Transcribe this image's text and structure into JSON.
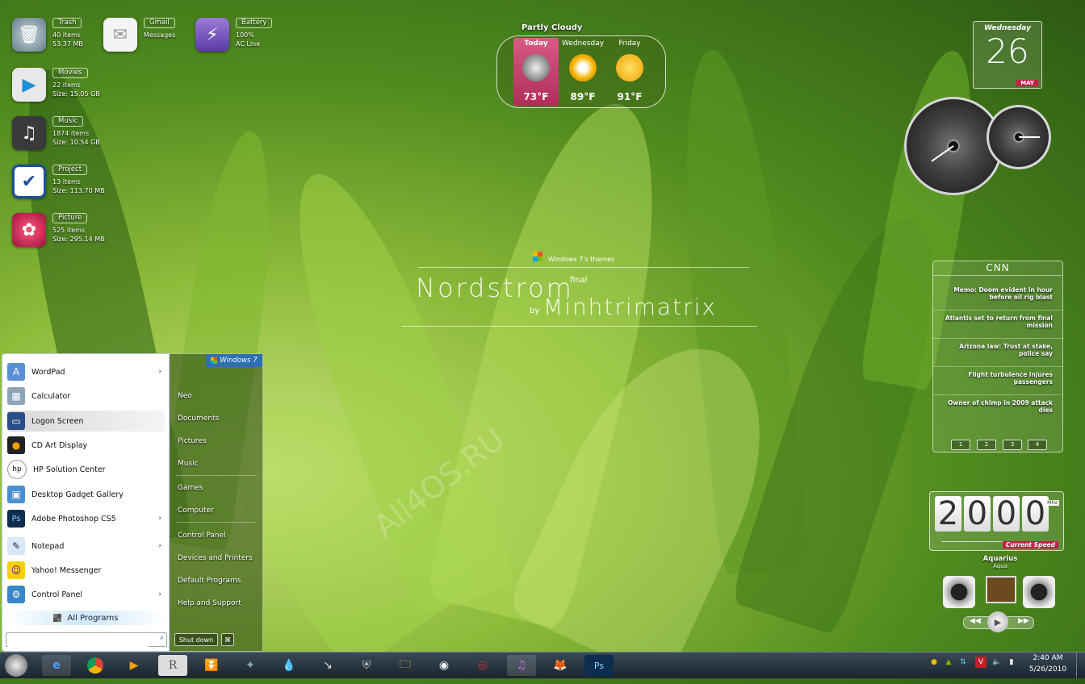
{
  "desktop": {
    "icons": [
      {
        "name": "Trash",
        "line1": "40 items",
        "line2": "53.37 MB"
      },
      {
        "name": "Gmail",
        "line1": "Messages",
        "line2": ""
      },
      {
        "name": "Battery",
        "line1": "100%",
        "line2": "AC Line"
      },
      {
        "name": "Movies",
        "line1": "22 items",
        "line2": "Size: 15.05 GB"
      },
      {
        "name": "Music",
        "line1": "1874 items",
        "line2": "Size: 10.54 GB"
      },
      {
        "name": "Project",
        "line1": "13 items",
        "line2": "Size: 113.70 MB"
      },
      {
        "name": "Picture",
        "line1": "525 items",
        "line2": "Size: 295.14 MB"
      }
    ],
    "banner": {
      "subtitle": "Windows 7's themes",
      "title": "Nordstrom",
      "final": "final",
      "by": "by",
      "author": "Minhtrimatrix"
    },
    "watermark": "All4OS.RU"
  },
  "weather": {
    "condition": "Partly Cloudy",
    "days": [
      {
        "label": "Today",
        "temp": "73°F"
      },
      {
        "label": "Wednesday",
        "temp": "89°F"
      },
      {
        "label": "Friday",
        "temp": "91°F"
      }
    ]
  },
  "calendar": {
    "weekday": "Wednesday",
    "day": "26",
    "month": "MAY"
  },
  "cnn": {
    "title": "CNN",
    "items": [
      "Memo: Doom evident in hour before oil rig blast",
      "Atlantis set to return from final mission",
      "Arizona law: Trust at stake, police say",
      "Flight turbulence injures passengers",
      "Owner of chimp in 2009 attack dies"
    ],
    "pages": [
      "1",
      "2",
      "3",
      "4"
    ]
  },
  "cpu": {
    "digits": [
      "2",
      "0",
      "0",
      "0"
    ],
    "unit": "MHz",
    "label": "Current Speed"
  },
  "player": {
    "title": "Aquarius",
    "subtitle": "Aqua"
  },
  "start_menu": {
    "badge": "Windows 7",
    "programs": [
      {
        "label": "WordPad",
        "arrow": "›"
      },
      {
        "label": "Calculator",
        "arrow": ""
      },
      {
        "label": "Logon Screen",
        "arrow": ""
      },
      {
        "label": "CD Art Display",
        "arrow": ""
      },
      {
        "label": "HP Solution Center",
        "arrow": ""
      },
      {
        "label": "Desktop Gadget Gallery",
        "arrow": ""
      },
      {
        "label": "Adobe Photoshop CS5",
        "arrow": "›"
      },
      {
        "label": "Notepad",
        "arrow": "›"
      },
      {
        "label": "Yahoo! Messenger",
        "arrow": ""
      },
      {
        "label": "Control Panel",
        "arrow": "›"
      }
    ],
    "all_programs": "All Programs",
    "search_placeholder": "",
    "right_links": [
      "Neo",
      "Documents",
      "Pictures",
      "Music",
      "Games",
      "Computer",
      "Control Panel",
      "Devices and Printers",
      "Default Programs",
      "Help and Support"
    ],
    "shutdown": "Shut down"
  },
  "taskbar": {
    "clock_time": "2:40 AM",
    "clock_date": "5/26/2010"
  }
}
